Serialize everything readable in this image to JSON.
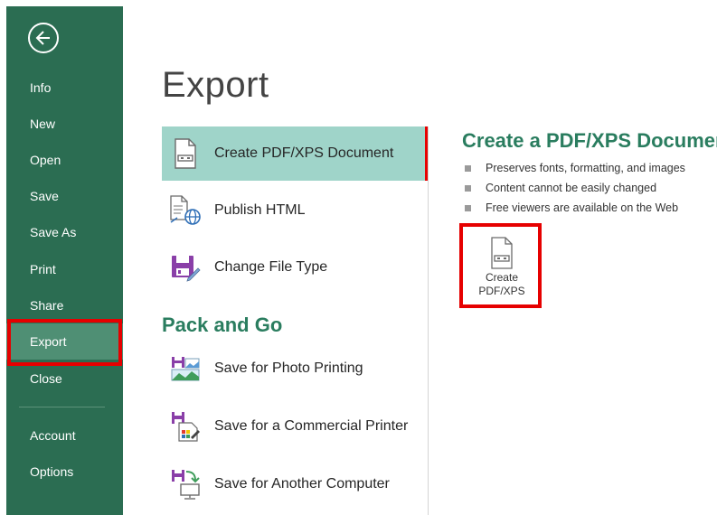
{
  "sidebar": {
    "back_label": "Back",
    "items": [
      {
        "label": "Info"
      },
      {
        "label": "New"
      },
      {
        "label": "Open"
      },
      {
        "label": "Save"
      },
      {
        "label": "Save As"
      },
      {
        "label": "Print"
      },
      {
        "label": "Share"
      },
      {
        "label": "Export",
        "selected": true
      },
      {
        "label": "Close"
      },
      {
        "label": "Account"
      },
      {
        "label": "Options"
      }
    ]
  },
  "page": {
    "title": "Export"
  },
  "options": [
    {
      "label": "Create PDF/XPS Document",
      "icon": "pdf-document-icon",
      "selected": true
    },
    {
      "label": "Publish HTML",
      "icon": "publish-html-icon"
    },
    {
      "label": "Change File Type",
      "icon": "change-file-type-icon"
    }
  ],
  "pack_and_go": {
    "heading": "Pack and Go",
    "items": [
      {
        "label": "Save for Photo Printing",
        "icon": "photo-printing-icon"
      },
      {
        "label": "Save for a Commercial Printer",
        "icon": "commercial-printer-icon"
      },
      {
        "label": "Save for Another Computer",
        "icon": "another-computer-icon"
      }
    ]
  },
  "detail": {
    "title": "Create a PDF/XPS Document",
    "bullets": [
      "Preserves fonts, formatting, and images",
      "Content cannot be easily changed",
      "Free viewers are available on the Web"
    ],
    "button_line1": "Create",
    "button_line2": "PDF/XPS"
  },
  "colors": {
    "sidebar_bg": "#2b6d52",
    "sidebar_selected": "#4f8f74",
    "option_selected": "#9fd4c9",
    "accent_text": "#2a7d5f",
    "highlight": "#e60000"
  }
}
